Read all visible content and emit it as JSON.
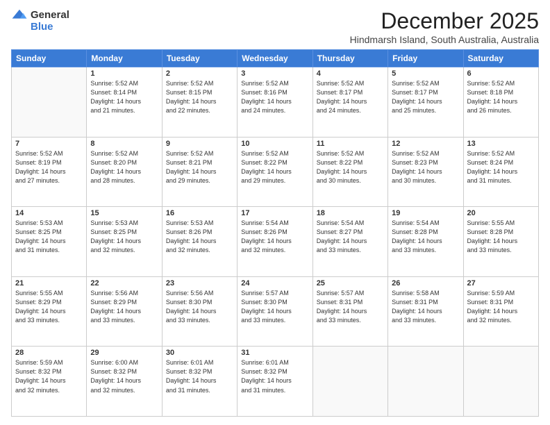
{
  "logo": {
    "general": "General",
    "blue": "Blue"
  },
  "title": "December 2025",
  "subtitle": "Hindmarsh Island, South Australia, Australia",
  "days_of_week": [
    "Sunday",
    "Monday",
    "Tuesday",
    "Wednesday",
    "Thursday",
    "Friday",
    "Saturday"
  ],
  "weeks": [
    [
      {
        "day": "",
        "info": ""
      },
      {
        "day": "1",
        "info": "Sunrise: 5:52 AM\nSunset: 8:14 PM\nDaylight: 14 hours\nand 21 minutes."
      },
      {
        "day": "2",
        "info": "Sunrise: 5:52 AM\nSunset: 8:15 PM\nDaylight: 14 hours\nand 22 minutes."
      },
      {
        "day": "3",
        "info": "Sunrise: 5:52 AM\nSunset: 8:16 PM\nDaylight: 14 hours\nand 24 minutes."
      },
      {
        "day": "4",
        "info": "Sunrise: 5:52 AM\nSunset: 8:17 PM\nDaylight: 14 hours\nand 24 minutes."
      },
      {
        "day": "5",
        "info": "Sunrise: 5:52 AM\nSunset: 8:17 PM\nDaylight: 14 hours\nand 25 minutes."
      },
      {
        "day": "6",
        "info": "Sunrise: 5:52 AM\nSunset: 8:18 PM\nDaylight: 14 hours\nand 26 minutes."
      }
    ],
    [
      {
        "day": "7",
        "info": "Sunrise: 5:52 AM\nSunset: 8:19 PM\nDaylight: 14 hours\nand 27 minutes."
      },
      {
        "day": "8",
        "info": "Sunrise: 5:52 AM\nSunset: 8:20 PM\nDaylight: 14 hours\nand 28 minutes."
      },
      {
        "day": "9",
        "info": "Sunrise: 5:52 AM\nSunset: 8:21 PM\nDaylight: 14 hours\nand 29 minutes."
      },
      {
        "day": "10",
        "info": "Sunrise: 5:52 AM\nSunset: 8:22 PM\nDaylight: 14 hours\nand 29 minutes."
      },
      {
        "day": "11",
        "info": "Sunrise: 5:52 AM\nSunset: 8:22 PM\nDaylight: 14 hours\nand 30 minutes."
      },
      {
        "day": "12",
        "info": "Sunrise: 5:52 AM\nSunset: 8:23 PM\nDaylight: 14 hours\nand 30 minutes."
      },
      {
        "day": "13",
        "info": "Sunrise: 5:52 AM\nSunset: 8:24 PM\nDaylight: 14 hours\nand 31 minutes."
      }
    ],
    [
      {
        "day": "14",
        "info": "Sunrise: 5:53 AM\nSunset: 8:25 PM\nDaylight: 14 hours\nand 31 minutes."
      },
      {
        "day": "15",
        "info": "Sunrise: 5:53 AM\nSunset: 8:25 PM\nDaylight: 14 hours\nand 32 minutes."
      },
      {
        "day": "16",
        "info": "Sunrise: 5:53 AM\nSunset: 8:26 PM\nDaylight: 14 hours\nand 32 minutes."
      },
      {
        "day": "17",
        "info": "Sunrise: 5:54 AM\nSunset: 8:26 PM\nDaylight: 14 hours\nand 32 minutes."
      },
      {
        "day": "18",
        "info": "Sunrise: 5:54 AM\nSunset: 8:27 PM\nDaylight: 14 hours\nand 33 minutes."
      },
      {
        "day": "19",
        "info": "Sunrise: 5:54 AM\nSunset: 8:28 PM\nDaylight: 14 hours\nand 33 minutes."
      },
      {
        "day": "20",
        "info": "Sunrise: 5:55 AM\nSunset: 8:28 PM\nDaylight: 14 hours\nand 33 minutes."
      }
    ],
    [
      {
        "day": "21",
        "info": "Sunrise: 5:55 AM\nSunset: 8:29 PM\nDaylight: 14 hours\nand 33 minutes."
      },
      {
        "day": "22",
        "info": "Sunrise: 5:56 AM\nSunset: 8:29 PM\nDaylight: 14 hours\nand 33 minutes."
      },
      {
        "day": "23",
        "info": "Sunrise: 5:56 AM\nSunset: 8:30 PM\nDaylight: 14 hours\nand 33 minutes."
      },
      {
        "day": "24",
        "info": "Sunrise: 5:57 AM\nSunset: 8:30 PM\nDaylight: 14 hours\nand 33 minutes."
      },
      {
        "day": "25",
        "info": "Sunrise: 5:57 AM\nSunset: 8:31 PM\nDaylight: 14 hours\nand 33 minutes."
      },
      {
        "day": "26",
        "info": "Sunrise: 5:58 AM\nSunset: 8:31 PM\nDaylight: 14 hours\nand 33 minutes."
      },
      {
        "day": "27",
        "info": "Sunrise: 5:59 AM\nSunset: 8:31 PM\nDaylight: 14 hours\nand 32 minutes."
      }
    ],
    [
      {
        "day": "28",
        "info": "Sunrise: 5:59 AM\nSunset: 8:32 PM\nDaylight: 14 hours\nand 32 minutes."
      },
      {
        "day": "29",
        "info": "Sunrise: 6:00 AM\nSunset: 8:32 PM\nDaylight: 14 hours\nand 32 minutes."
      },
      {
        "day": "30",
        "info": "Sunrise: 6:01 AM\nSunset: 8:32 PM\nDaylight: 14 hours\nand 31 minutes."
      },
      {
        "day": "31",
        "info": "Sunrise: 6:01 AM\nSunset: 8:32 PM\nDaylight: 14 hours\nand 31 minutes."
      },
      {
        "day": "",
        "info": ""
      },
      {
        "day": "",
        "info": ""
      },
      {
        "day": "",
        "info": ""
      }
    ]
  ]
}
